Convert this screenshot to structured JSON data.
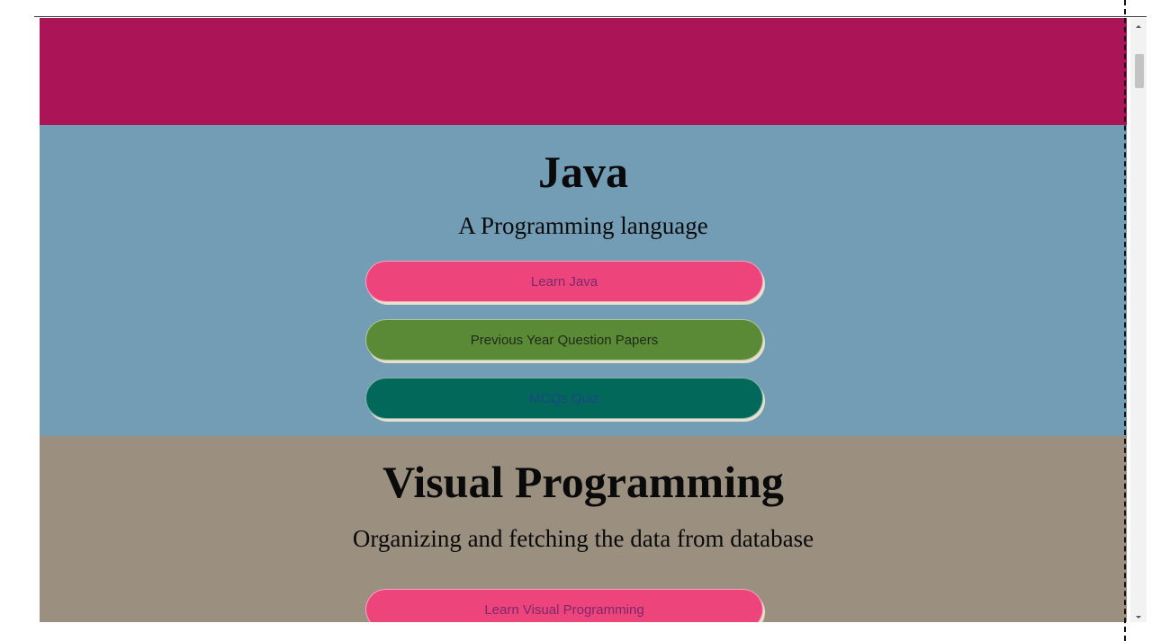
{
  "colors": {
    "header_band": "#ab1456",
    "java_section_bg": "#729db5",
    "vp_section_bg": "#9b9080",
    "pink_button": "#ee447c",
    "green_button": "#5a8a35",
    "teal_button": "#02695a"
  },
  "java": {
    "title": "Java",
    "subtitle": "A Programming language",
    "buttons": {
      "learn": "Learn Java",
      "papers": "Previous Year Question Papers",
      "quiz": "MCQs Quiz"
    }
  },
  "visual_programming": {
    "title": "Visual Programming",
    "subtitle": "Organizing and fetching the data from database",
    "buttons": {
      "learn": "Learn Visual Programming"
    }
  },
  "icons": {
    "scroll_up": "chevron-up-icon",
    "scroll_down": "chevron-down-icon"
  }
}
